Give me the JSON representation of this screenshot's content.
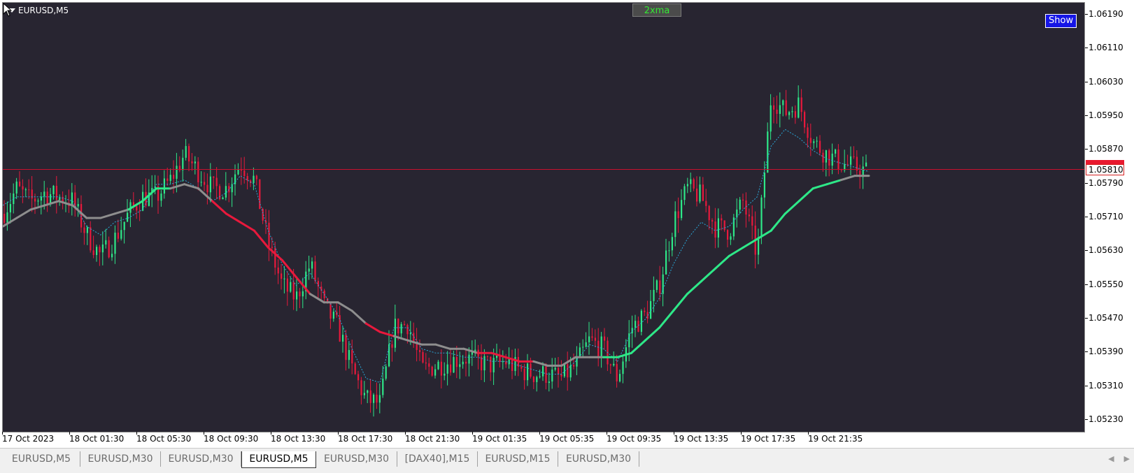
{
  "chart_data": {
    "type": "candlestick",
    "symbol_label": "EURUSD,M5",
    "indicator_label": "2xma",
    "show_button": "Show",
    "ylim": [
      1.052,
      1.0622
    ],
    "y_ticks": [
      "1.06190",
      "1.06110",
      "1.06030",
      "1.05950",
      "1.05870",
      "1.05790",
      "1.05710",
      "1.05630",
      "1.05550",
      "1.05470",
      "1.05390",
      "1.05310",
      "1.05230"
    ],
    "current_price_label": "1.05810",
    "current_price": 1.05825,
    "x_ticks": [
      "17 Oct 2023",
      "18 Oct 01:30",
      "18 Oct 05:30",
      "18 Oct 09:30",
      "18 Oct 13:30",
      "18 Oct 17:30",
      "18 Oct 21:30",
      "19 Oct 01:35",
      "19 Oct 05:35",
      "19 Oct 09:35",
      "19 Oct 13:35",
      "19 Oct 17:35",
      "19 Oct 21:35"
    ],
    "price_path": [
      1.0572,
      1.0578,
      1.0575,
      1.0577,
      1.0576,
      1.0575,
      1.0567,
      1.0562,
      1.0566,
      1.0572,
      1.0576,
      1.0576,
      1.058,
      1.0586,
      1.0582,
      1.0578,
      1.0578,
      1.0584,
      1.058,
      1.0565,
      1.0555,
      1.0552,
      1.056,
      1.055,
      1.0545,
      1.0535,
      1.0528,
      1.0527,
      1.0545,
      1.0546,
      1.0535,
      1.0536,
      1.0537,
      1.0538,
      1.0537,
      1.0536,
      1.0537,
      1.0535,
      1.0534,
      1.0534,
      1.0533,
      1.0536,
      1.0542,
      1.054,
      1.0533,
      1.0545,
      1.0548,
      1.0555,
      1.057,
      1.0578,
      1.0576,
      1.0569,
      1.0568,
      1.0575,
      1.0562,
      1.06,
      1.0596,
      1.0598,
      1.0589,
      1.0586,
      1.0584,
      1.0583,
      1.0582
    ],
    "slow_ma": [
      1.0569,
      1.0571,
      1.0573,
      1.0574,
      1.0575,
      1.0574,
      1.0571,
      1.0571,
      1.0572,
      1.0573,
      1.0575,
      1.0578,
      1.0578,
      1.0579,
      1.0578,
      1.0575,
      1.0572,
      1.057,
      1.0568,
      1.0564,
      1.0561,
      1.0557,
      1.0553,
      1.0551,
      1.0551,
      1.0549,
      1.0546,
      1.0544,
      1.0543,
      1.0542,
      1.0541,
      1.0541,
      1.054,
      1.054,
      1.0539,
      1.0539,
      1.0538,
      1.0537,
      1.0537,
      1.0536,
      1.0536,
      1.0538,
      1.0538,
      1.0538,
      1.0538,
      1.0539,
      1.0542,
      1.0545,
      1.0549,
      1.0553,
      1.0556,
      1.0559,
      1.0562,
      1.0564,
      1.0566,
      1.0568,
      1.0572,
      1.0575,
      1.0578,
      1.0579,
      1.058,
      1.0581,
      1.0581
    ],
    "fast_ma": [
      1.0574,
      1.0576,
      1.0576,
      1.0576,
      1.0576,
      1.0575,
      1.0569,
      1.0567,
      1.057,
      1.0571,
      1.0573,
      1.0579,
      1.0579,
      1.058,
      1.0578,
      1.0575,
      1.0577,
      1.0581,
      1.0579,
      1.0568,
      1.056,
      1.0555,
      1.0558,
      1.0553,
      1.0548,
      1.054,
      1.0533,
      1.0532,
      1.0545,
      1.0545,
      1.054,
      1.0539,
      1.0539,
      1.0538,
      1.0538,
      1.0537,
      1.0537,
      1.0536,
      1.0535,
      1.0534,
      1.0534,
      1.0537,
      1.0541,
      1.054,
      1.0537,
      1.0544,
      1.0547,
      1.0552,
      1.056,
      1.0566,
      1.057,
      1.0568,
      1.0569,
      1.0573,
      1.0576,
      1.0588,
      1.0592,
      1.059,
      1.0587,
      1.0585,
      1.0584,
      1.0583,
      1.0582
    ],
    "slow_ma_colors": [
      "#8e8e8e",
      "#8e8e8e",
      "#8e8e8e",
      "#8e8e8e",
      "#8e8e8e",
      "#8e8e8e",
      "#8e8e8e",
      "#8e8e8e",
      "#8e8e8e",
      "#2ee888",
      "#2ee888",
      "#2ee888",
      "#8e8e8e",
      "#8e8e8e",
      "#8e8e8e",
      "#e8193c",
      "#e8193c",
      "#e8193c",
      "#e8193c",
      "#e8193c",
      "#e8193c",
      "#e8193c",
      "#8e8e8e",
      "#8e8e8e",
      "#8e8e8e",
      "#8e8e8e",
      "#e8193c",
      "#e8193c",
      "#8e8e8e",
      "#8e8e8e",
      "#8e8e8e",
      "#8e8e8e",
      "#8e8e8e",
      "#8e8e8e",
      "#e8193c",
      "#e8193c",
      "#e8193c",
      "#e8193c",
      "#8e8e8e",
      "#8e8e8e",
      "#8e8e8e",
      "#8e8e8e",
      "#8e8e8e",
      "#2ee888",
      "#2ee888",
      "#2ee888",
      "#2ee888",
      "#2ee888",
      "#2ee888",
      "#2ee888",
      "#2ee888",
      "#2ee888",
      "#2ee888",
      "#2ee888",
      "#2ee888",
      "#2ee888",
      "#2ee888",
      "#2ee888",
      "#2ee888",
      "#2ee888",
      "#8e8e8e",
      "#8e8e8e"
    ],
    "colors": {
      "background": "#282531",
      "bull": "#2ee888",
      "bear": "#e8193c",
      "neutral": "#8e8e8e",
      "fast_ma": "#2aa7d8",
      "price_line": "#c8102e"
    }
  },
  "tabs": [
    {
      "label": "EURUSD,M5",
      "active": false
    },
    {
      "label": "EURUSD,M30",
      "active": false
    },
    {
      "label": "EURUSD,M30",
      "active": false
    },
    {
      "label": "EURUSD,M5",
      "active": true
    },
    {
      "label": "EURUSD,M30",
      "active": false
    },
    {
      "label": "[DAX40],M15",
      "active": false
    },
    {
      "label": "EURUSD,M15",
      "active": false
    },
    {
      "label": "EURUSD,M30",
      "active": false
    }
  ],
  "tab_nav": {
    "prev": "◀",
    "next": "▶"
  }
}
